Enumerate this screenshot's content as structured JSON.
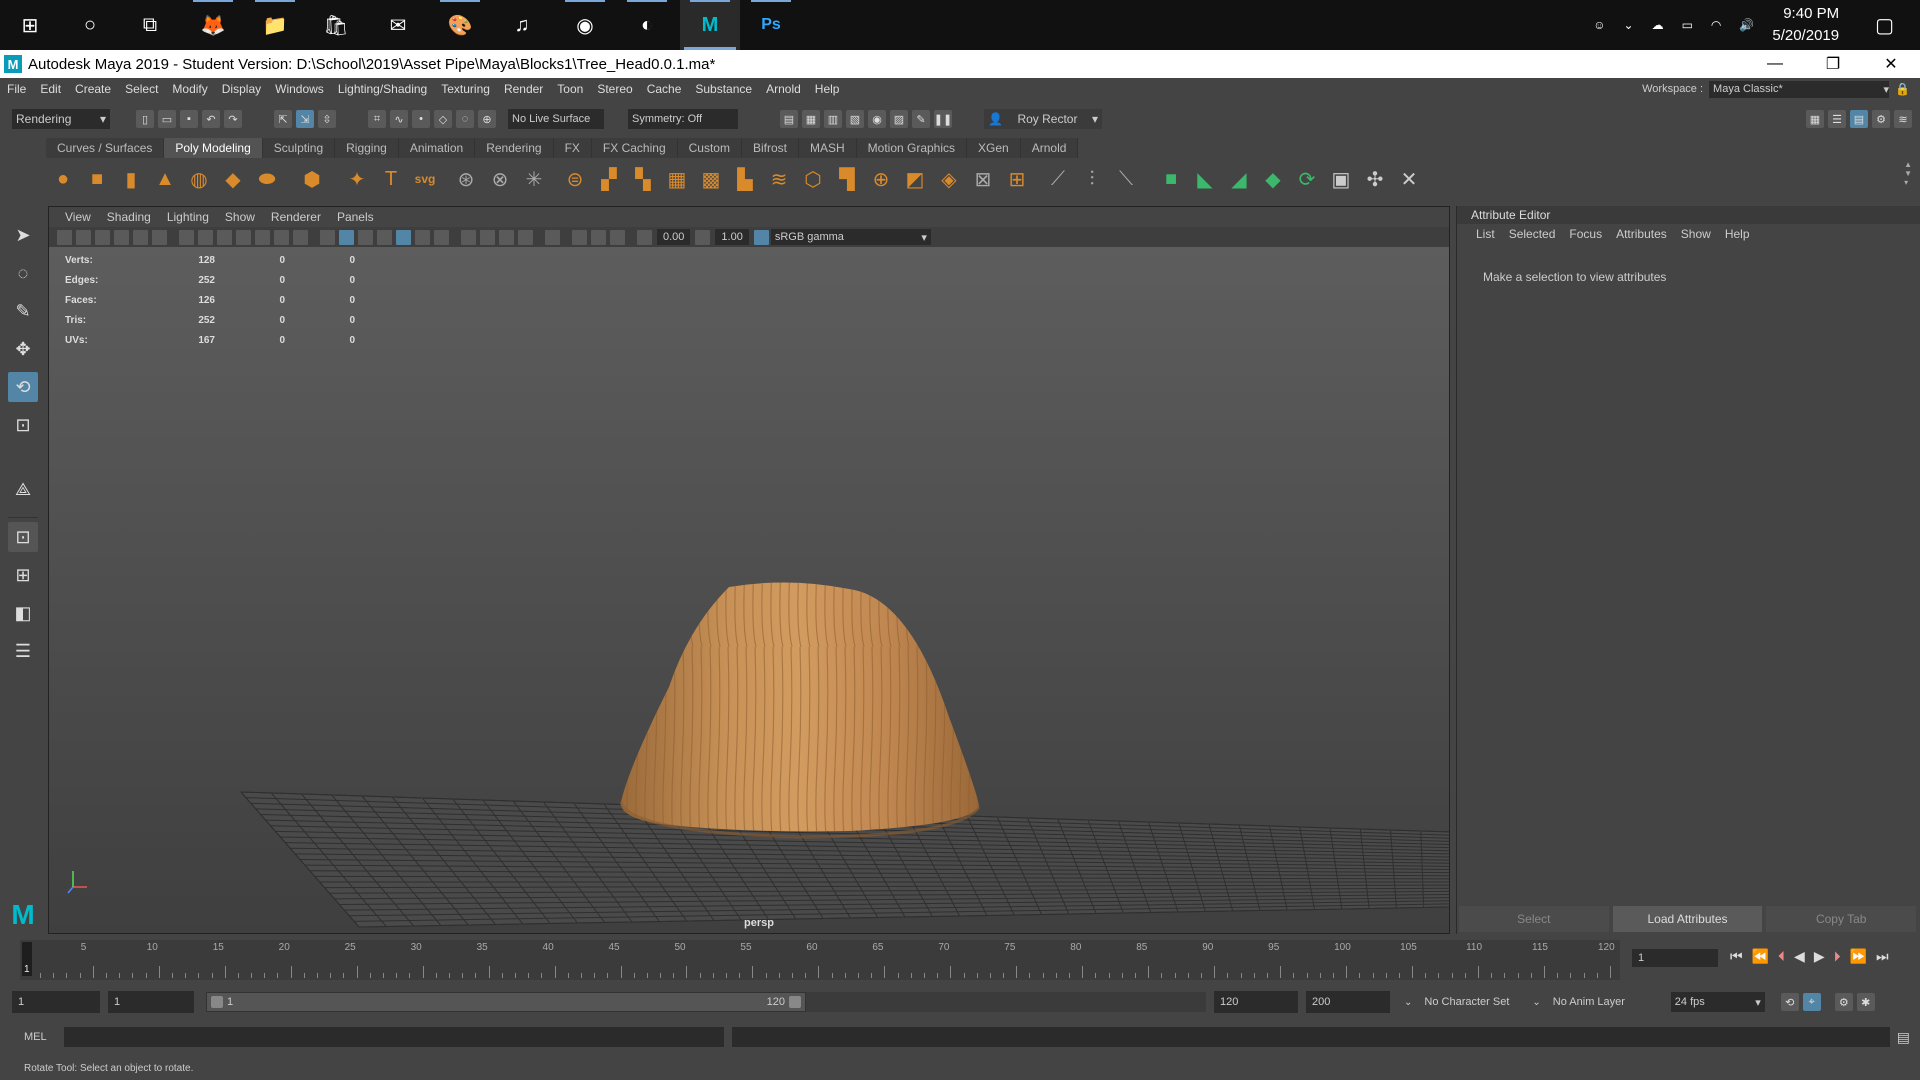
{
  "taskbar": {
    "apps": [
      {
        "name": "windows-start",
        "glyph": "⊞"
      },
      {
        "name": "cortana",
        "glyph": "○"
      },
      {
        "name": "task-view",
        "glyph": "⧉"
      },
      {
        "name": "firefox",
        "glyph": "🦊"
      },
      {
        "name": "file-explorer",
        "glyph": "📁"
      },
      {
        "name": "microsoft-store",
        "glyph": "🛍"
      },
      {
        "name": "mail",
        "glyph": "✉"
      },
      {
        "name": "paint",
        "glyph": "🎨"
      },
      {
        "name": "itunes",
        "glyph": "♫"
      },
      {
        "name": "discord",
        "glyph": "◉"
      },
      {
        "name": "github",
        "glyph": "◐"
      },
      {
        "name": "maya",
        "glyph": "M"
      },
      {
        "name": "photoshop",
        "glyph": "Ps"
      }
    ],
    "time": "9:40 PM",
    "date": "5/20/2019"
  },
  "window": {
    "title": "Autodesk Maya 2019 - Student Version: D:\\School\\2019\\Asset Pipe\\Maya\\Blocks1\\Tree_Head0.0.1.ma*",
    "minimize": "—",
    "restore": "❐",
    "close": "✕"
  },
  "menubar": {
    "items": [
      "File",
      "Edit",
      "Create",
      "Select",
      "Modify",
      "Display",
      "Windows",
      "Lighting/Shading",
      "Texturing",
      "Render",
      "Toon",
      "Stereo",
      "Cache",
      "Substance",
      "Arnold",
      "Help"
    ],
    "workspace_label": "Workspace :",
    "workspace_value": "Maya Classic*"
  },
  "statusline": {
    "menuset": "Rendering",
    "live_surface": "No Live Surface",
    "symmetry": "Symmetry: Off",
    "user": "Roy Rector"
  },
  "shelf": {
    "tabs": [
      "Curves / Surfaces",
      "Poly Modeling",
      "Sculpting",
      "Rigging",
      "Animation",
      "Rendering",
      "FX",
      "FX Caching",
      "Custom",
      "Bifrost",
      "MASH",
      "Motion Graphics",
      "XGen",
      "Arnold"
    ],
    "active_tab": "Poly Modeling"
  },
  "viewport": {
    "menu": [
      "View",
      "Shading",
      "Lighting",
      "Show",
      "Renderer",
      "Panels"
    ],
    "exposure": "0.00",
    "gamma": "1.00",
    "colorspace": "sRGB gamma",
    "camera": "persp",
    "hud": [
      {
        "label": "Verts:",
        "v1": "128",
        "v2": "0",
        "v3": "0"
      },
      {
        "label": "Edges:",
        "v1": "252",
        "v2": "0",
        "v3": "0"
      },
      {
        "label": "Faces:",
        "v1": "126",
        "v2": "0",
        "v3": "0"
      },
      {
        "label": "Tris:",
        "v1": "252",
        "v2": "0",
        "v3": "0"
      },
      {
        "label": "UVs:",
        "v1": "167",
        "v2": "0",
        "v3": "0"
      }
    ]
  },
  "attribute_editor": {
    "title": "Attribute Editor",
    "menu": [
      "List",
      "Selected",
      "Focus",
      "Attributes",
      "Show",
      "Help"
    ],
    "message": "Make a selection to view attributes",
    "btn_select": "Select",
    "btn_load": "Load Attributes",
    "btn_copy": "Copy Tab"
  },
  "timeslider": {
    "ticks": [
      "5",
      "10",
      "15",
      "20",
      "25",
      "30",
      "35",
      "40",
      "45",
      "50",
      "55",
      "60",
      "65",
      "70",
      "75",
      "80",
      "85",
      "90",
      "95",
      "100",
      "105",
      "110",
      "115",
      "120"
    ],
    "current_frame_field": "1",
    "current_marker": "1"
  },
  "rangebar": {
    "start": "1",
    "playback_start": "1",
    "range_start": "1",
    "range_end": "120",
    "playback_end": "120",
    "end": "200",
    "character_set": "No Character Set",
    "anim_layer": "No Anim Layer",
    "fps": "24 fps"
  },
  "mel": {
    "label": "MEL"
  },
  "helpline": "Rotate Tool: Select an object to rotate."
}
